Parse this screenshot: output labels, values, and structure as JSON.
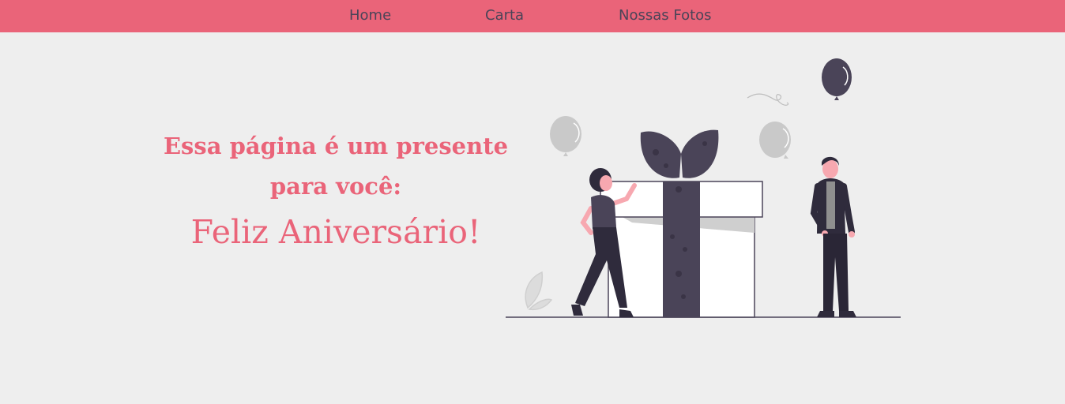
{
  "nav": {
    "links": [
      {
        "label": "Home"
      },
      {
        "label": "Carta"
      },
      {
        "label": "Nossas Fotos"
      }
    ]
  },
  "hero": {
    "heading": "Essa página é um presente para você:",
    "subheading": "Feliz Aniversário!"
  },
  "colors": {
    "accent": "#ea6479",
    "nav_text": "#4a4458",
    "background": "#eeeeee",
    "dark_purple": "#4a4458",
    "balloon_gray": "#cccccc"
  },
  "illustration": {
    "subject": "gift-celebration"
  }
}
